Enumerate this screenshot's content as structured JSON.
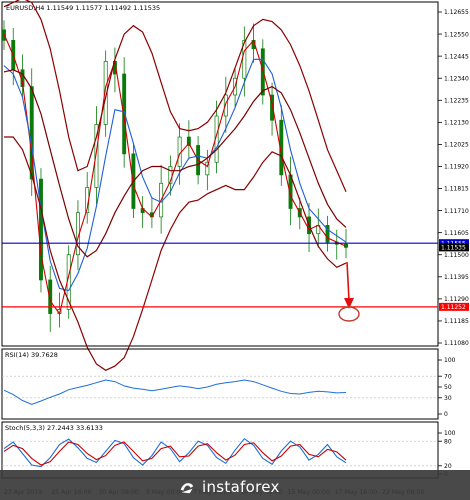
{
  "chart_data": [
    {
      "type": "line",
      "symbol_line": "EURUSD,H4  1.11549 1.11577 1.11492 1.11535",
      "title": "",
      "price_ticks": [
        "1.12655",
        "1.12550",
        "1.12445",
        "1.12340",
        "1.12235",
        "1.12130",
        "1.12025",
        "1.11920",
        "1.11815",
        "1.11710",
        "1.11605",
        "1.11500",
        "1.11395",
        "1.11290",
        "1.11185",
        "1.11080"
      ],
      "ylim": [
        1.1108,
        1.12655
      ],
      "date_ticks": [
        "23 Apr 2019",
        "25 Apr 16:00",
        "30 Apr 08:00",
        "3 May 00:00",
        "7 May 16:00",
        "10 May 08:00",
        "15 May 00:00",
        "17 May 16:00",
        "22 May 08:00"
      ],
      "series": [
        {
          "values": [
            1.1255,
            1.1245,
            1.1232,
            1.1198,
            1.115,
            1.1128,
            1.1122,
            1.114,
            1.1158,
            1.1172,
            1.1199,
            1.123,
            1.1242,
            1.1215,
            1.1183,
            1.1172,
            1.1168,
            1.1176,
            1.1185,
            1.1198,
            1.1203,
            1.1195,
            1.1192,
            1.1207,
            1.1222,
            1.123,
            1.1247,
            1.1252,
            1.1238,
            1.1222,
            1.1198,
            1.1178,
            1.117,
            1.1162,
            1.1164,
            1.1158,
            1.1156,
            1.1154
          ],
          "color": "#cc0000"
        },
        {
          "values": [
            1.124,
            1.1236,
            1.1225,
            1.1202,
            1.1172,
            1.1147,
            1.1134,
            1.1133,
            1.1141,
            1.1153,
            1.1173,
            1.1197,
            1.1219,
            1.1218,
            1.1203,
            1.1187,
            1.1177,
            1.1175,
            1.118,
            1.1189,
            1.1196,
            1.1197,
            1.1196,
            1.1201,
            1.121,
            1.122,
            1.1232,
            1.1243,
            1.1243,
            1.1236,
            1.122,
            1.12,
            1.1184,
            1.1172,
            1.1167,
            1.1162,
            1.1159,
            1.1156
          ],
          "color": "#1f5fd8"
        },
        {
          "values": [
            1.1237,
            1.1238,
            1.1236,
            1.1229,
            1.1217,
            1.12,
            1.1183,
            1.1167,
            1.1154,
            1.1149,
            1.1152,
            1.116,
            1.117,
            1.1178,
            1.1185,
            1.119,
            1.1192,
            1.1192,
            1.119,
            1.119,
            1.1192,
            1.1193,
            1.1196,
            1.12,
            1.1205,
            1.121,
            1.1216,
            1.1223,
            1.1228,
            1.123,
            1.1227,
            1.1219,
            1.1208,
            1.1196,
            1.1184,
            1.1174,
            1.1167,
            1.1163
          ],
          "color": "#7a0000"
        },
        {
          "values": [
            1.1268,
            1.127,
            1.1272,
            1.127,
            1.1262,
            1.1248,
            1.1228,
            1.1206,
            1.119,
            1.1192,
            1.1206,
            1.1225,
            1.1243,
            1.1255,
            1.1259,
            1.1256,
            1.1246,
            1.1232,
            1.1218,
            1.121,
            1.1209,
            1.121,
            1.1213,
            1.1219,
            1.1227,
            1.1239,
            1.1251,
            1.1259,
            1.1262,
            1.1261,
            1.1257,
            1.125,
            1.124,
            1.1228,
            1.1214,
            1.12,
            1.119,
            1.118
          ],
          "color": "#8b0000"
        },
        {
          "values": [
            1.1206,
            1.1206,
            1.12,
            1.1188,
            1.1172,
            1.1152,
            1.1138,
            1.1128,
            1.1118,
            1.1106,
            1.1098,
            1.1095,
            1.1097,
            1.1101,
            1.1111,
            1.1124,
            1.1138,
            1.1152,
            1.1162,
            1.117,
            1.1175,
            1.1176,
            1.1179,
            1.1181,
            1.1183,
            1.1181,
            1.1181,
            1.1187,
            1.1194,
            1.1199,
            1.1197,
            1.1188,
            1.1176,
            1.1164,
            1.1154,
            1.1148,
            1.1144,
            1.1146
          ],
          "color": "#8b0000"
        }
      ],
      "candle_close": [
        1.1252,
        1.1238,
        1.123,
        1.1186,
        1.1138,
        1.1122,
        1.1124,
        1.115,
        1.117,
        1.1182,
        1.1212,
        1.1242,
        1.1236,
        1.1198,
        1.1172,
        1.117,
        1.1168,
        1.1184,
        1.1192,
        1.1206,
        1.1202,
        1.1188,
        1.1194,
        1.1216,
        1.1226,
        1.1234,
        1.1252,
        1.1248,
        1.1226,
        1.1214,
        1.1188,
        1.1172,
        1.1168,
        1.116,
        1.1164,
        1.1156,
        1.1155,
        1.11535
      ],
      "horizontal_lines": [
        {
          "label": "1.11555",
          "value": 1.11555,
          "color": "#0000cc",
          "label_bg": "#0000cc"
        },
        {
          "label": "1.11252",
          "value": 1.11252,
          "color": "#ff0000",
          "label_bg": "#ff0000"
        }
      ],
      "current_price_label": "1.11535",
      "annotation": "forecast arrow pointing down to circle at 1.11252"
    },
    {
      "type": "line",
      "label": "RSI(14) 39.7628",
      "ticks": [
        "100",
        "70",
        "50",
        "30",
        "0"
      ],
      "ylim": [
        0,
        100
      ],
      "series": [
        {
          "values": [
            44,
            36,
            25,
            18,
            24,
            31,
            37,
            45,
            49,
            53,
            58,
            63,
            60,
            52,
            48,
            46,
            43,
            46,
            49,
            52,
            50,
            47,
            50,
            55,
            58,
            60,
            63,
            60,
            54,
            48,
            42,
            38,
            37,
            40,
            42,
            41,
            39,
            39.76
          ],
          "color": "#1f6fd8"
        }
      ],
      "levels": [
        70,
        30
      ]
    },
    {
      "type": "line",
      "label": "Stoch(5,3,3) 27.2443 33.6133",
      "ticks": [
        "100",
        "80",
        "20",
        "0"
      ],
      "ylim": [
        0,
        100
      ],
      "series": [
        {
          "name": "",
          "values": [
            62,
            78,
            50,
            22,
            18,
            40,
            72,
            85,
            64,
            38,
            28,
            55,
            82,
            74,
            40,
            22,
            45,
            78,
            62,
            30,
            52,
            80,
            70,
            40,
            26,
            58,
            86,
            70,
            38,
            24,
            56,
            80,
            66,
            34,
            48,
            72,
            42,
            27.24
          ],
          "color": "#1f6fd8"
        },
        {
          "name": "",
          "values": [
            55,
            70,
            62,
            38,
            22,
            30,
            55,
            78,
            72,
            50,
            35,
            45,
            70,
            78,
            55,
            32,
            38,
            62,
            68,
            42,
            44,
            68,
            74,
            52,
            34,
            46,
            72,
            76,
            52,
            32,
            44,
            68,
            72,
            48,
            42,
            60,
            54,
            33.61
          ],
          "color": "#cc0000"
        }
      ],
      "levels": [
        80,
        20
      ]
    }
  ],
  "watermark": "instaforex"
}
